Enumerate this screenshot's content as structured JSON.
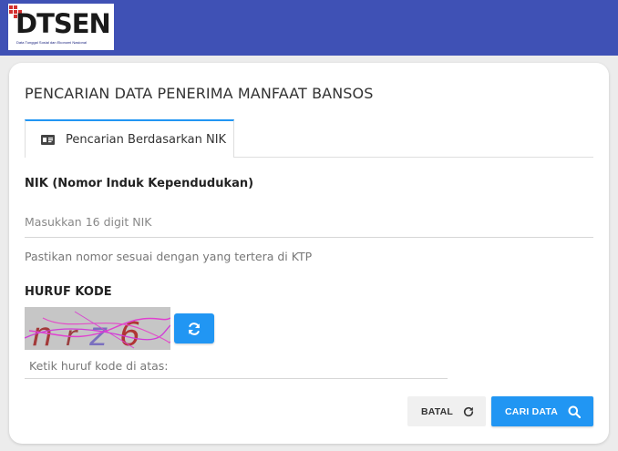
{
  "header": {
    "logo_text": "DTSEN",
    "logo_subtitle": "Data Tunggal Sosial dan Ekonomi Nasional",
    "bg_color": "#3f51b5"
  },
  "page": {
    "title": "PENCARIAN DATA PENERIMA MANFAAT BANSOS"
  },
  "tabs": [
    {
      "label": "Pencarian Berdasarkan NIK",
      "icon": "id-card-icon",
      "active": true
    }
  ],
  "nik": {
    "label": "NIK (Nomor Induk Kependudukan)",
    "placeholder": "Masukkan 16 digit NIK",
    "value": "",
    "hint": "Pastikan nomor sesuai dengan yang tertera di KTP"
  },
  "kode": {
    "label": "HURUF KODE",
    "captcha_text": "nrz6",
    "placeholder": "Ketik huruf kode di atas:",
    "value": ""
  },
  "actions": {
    "batal_label": "BATAL",
    "cari_label": "CARI DATA",
    "accent_color": "#2196f3"
  }
}
